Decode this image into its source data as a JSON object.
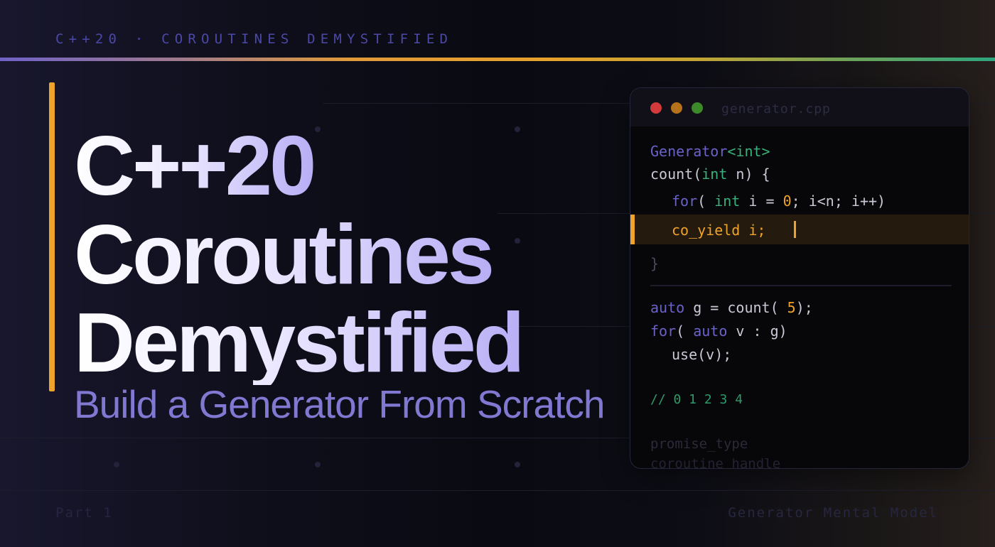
{
  "kicker": "C++20 · COROUTINES DEMYSTIFIED",
  "title": [
    "C++20",
    "Coroutines",
    "Demystified"
  ],
  "subtitle": "Build a Generator From Scratch",
  "footer": {
    "left": "Part 1",
    "right": "Generator Mental Model"
  },
  "colors": {
    "accent": "#f0a32a",
    "keyword": "#6a62c8",
    "type": "#3bb07a",
    "number": "#f0a32a",
    "background": "#0a0a12"
  },
  "code_window": {
    "filename": "generator.cpp",
    "traffic_lights": [
      "#d23b3b",
      "#b5721b",
      "#3d8a2a"
    ],
    "lines": {
      "l1_kw": "Generator",
      "l1_ty": "<int>",
      "l2_a": "count(",
      "l2_ty": "int",
      "l2_b": " n) {",
      "l3_kw": "for",
      "l3_a": "( ",
      "l3_ty": "int",
      "l3_b": " i = ",
      "l3_num": "0",
      "l3_c": "; i<n; i++)",
      "l4": "co_yield i;",
      "l5": "}",
      "l6_kw": "auto",
      "l6_a": " g = count( ",
      "l6_num": "5",
      "l6_b": ");",
      "l7_kw1": "for",
      "l7_a": "( ",
      "l7_kw2": "auto",
      "l7_b": " v : g)",
      "l8": "use(v);",
      "l9": "// 0 1 2 3 4",
      "l10": "promise_type",
      "l11": "coroutine_handle"
    }
  }
}
